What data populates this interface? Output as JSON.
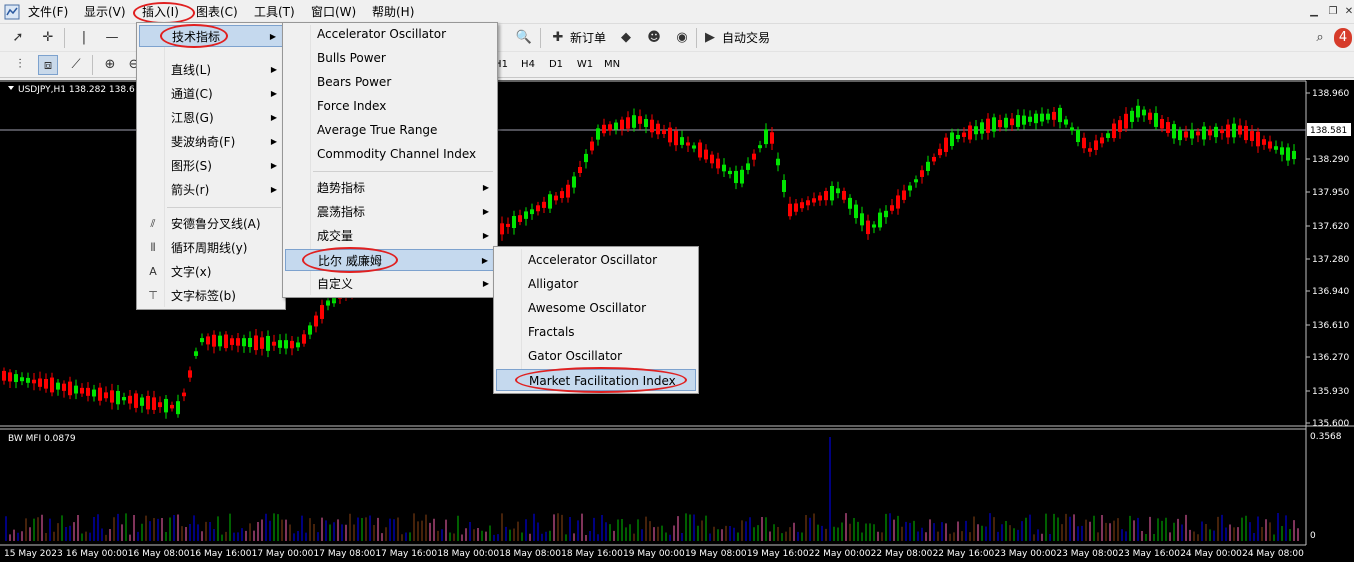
{
  "menubar": {
    "items": [
      "文件(F)",
      "显示(V)",
      "插入(I)",
      "图表(C)",
      "工具(T)",
      "窗口(W)",
      "帮助(H)"
    ]
  },
  "toolbar": {
    "new_order": "新订单",
    "auto_trade": "自动交易",
    "timeframes": [
      "H1",
      "H4",
      "D1",
      "W1",
      "MN"
    ]
  },
  "chart": {
    "symbol_info": "USDJPY,H1  138.282 138.6",
    "indicator_label": "BW MFI 0.0879",
    "indicator_max": "0.3568",
    "indicator_zero": "0",
    "current_price": "138.581",
    "price_ticks": [
      "138.960",
      "138.290",
      "137.950",
      "137.620",
      "137.280",
      "136.940",
      "136.610",
      "136.270",
      "135.930",
      "135.600"
    ],
    "time_ticks": [
      "15 May 2023",
      "16 May 00:00",
      "16 May 08:00",
      "16 May 16:00",
      "17 May 00:00",
      "17 May 08:00",
      "17 May 16:00",
      "18 May 00:00",
      "18 May 08:00",
      "18 May 16:00",
      "19 May 00:00",
      "19 May 08:00",
      "19 May 16:00",
      "22 May 00:00",
      "22 May 08:00",
      "22 May 16:00",
      "23 May 00:00",
      "23 May 08:00",
      "23 May 16:00",
      "24 May 00:00",
      "24 May 08:00"
    ],
    "colors": {
      "bull": "#00e600",
      "bear": "#ff0000",
      "bg": "#000000",
      "grid_text": "#ffffff"
    }
  },
  "insert_menu": {
    "items": [
      {
        "label": "技术指标",
        "submenu": true
      },
      {
        "label": "直线(L)",
        "submenu": true
      },
      {
        "label": "通道(C)",
        "submenu": true
      },
      {
        "label": "江恩(G)",
        "submenu": true
      },
      {
        "label": "斐波纳奇(F)",
        "submenu": true
      },
      {
        "label": "图形(S)",
        "submenu": true
      },
      {
        "label": "箭头(r)",
        "submenu": true
      },
      {
        "label": "安德鲁分叉线(A)",
        "icon": "pitchfork-icon"
      },
      {
        "label": "循环周期线(y)",
        "icon": "cycle-lines-icon"
      },
      {
        "label": "文字(x)",
        "icon": "text-icon"
      },
      {
        "label": "文字标签(b)",
        "icon": "text-label-icon"
      }
    ]
  },
  "indicators_menu": {
    "items": [
      {
        "label": "Accelerator Oscillator"
      },
      {
        "label": "Bulls Power"
      },
      {
        "label": "Bears Power"
      },
      {
        "label": "Force Index"
      },
      {
        "label": "Average True Range"
      },
      {
        "label": "Commodity Channel Index"
      },
      {
        "label": "趋势指标",
        "submenu": true
      },
      {
        "label": "震荡指标",
        "submenu": true
      },
      {
        "label": "成交量",
        "submenu": true
      },
      {
        "label": "比尔 威廉姆",
        "submenu": true
      },
      {
        "label": "自定义",
        "submenu": true
      }
    ]
  },
  "bill_williams_menu": {
    "items": [
      {
        "label": "Accelerator Oscillator"
      },
      {
        "label": "Alligator"
      },
      {
        "label": "Awesome Oscillator"
      },
      {
        "label": "Fractals"
      },
      {
        "label": "Gator Oscillator"
      },
      {
        "label": "Market Facilitation Index"
      }
    ]
  }
}
